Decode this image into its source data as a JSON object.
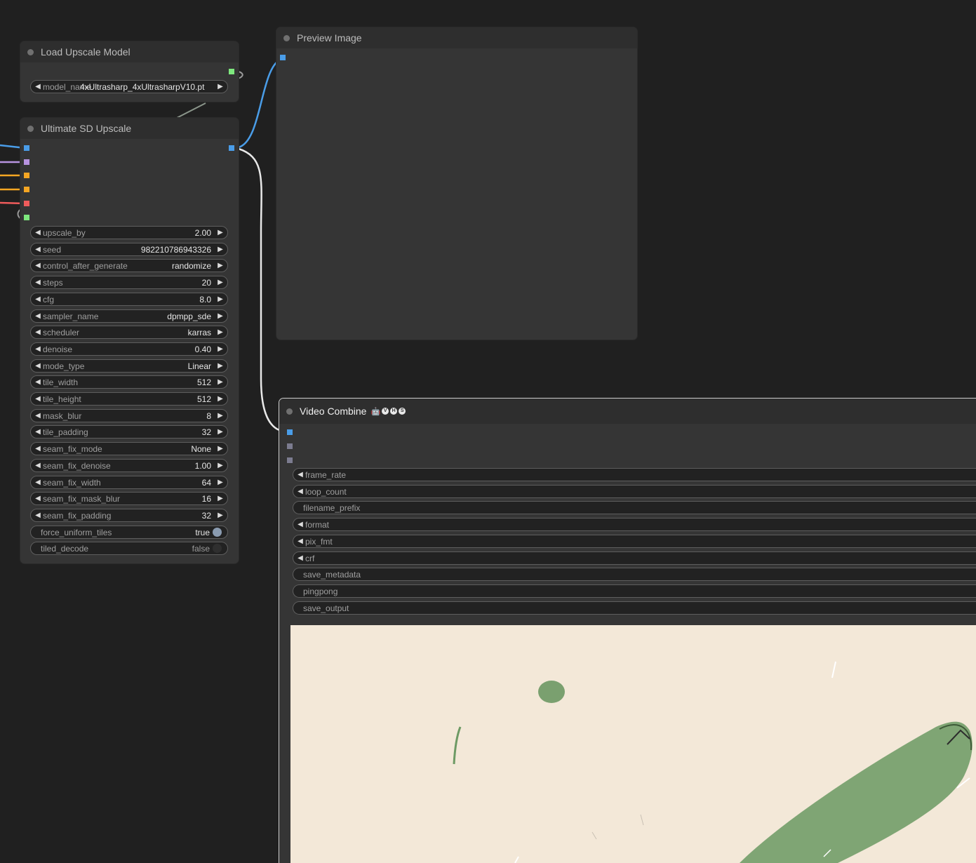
{
  "nodes": {
    "load_upscale": {
      "title": "Load Upscale Model",
      "model_name": {
        "label": "model_name",
        "value": "4xUltrasharp_4xUltrasharpV10.pt"
      }
    },
    "preview": {
      "title": "Preview Image"
    },
    "ultimate": {
      "title": "Ultimate SD Upscale",
      "widgets": [
        {
          "label": "upscale_by",
          "value": "2.00"
        },
        {
          "label": "seed",
          "value": "982210786943326"
        },
        {
          "label": "control_after_generate",
          "value": "randomize"
        },
        {
          "label": "steps",
          "value": "20"
        },
        {
          "label": "cfg",
          "value": "8.0"
        },
        {
          "label": "sampler_name",
          "value": "dpmpp_sde"
        },
        {
          "label": "scheduler",
          "value": "karras"
        },
        {
          "label": "denoise",
          "value": "0.40"
        },
        {
          "label": "mode_type",
          "value": "Linear"
        },
        {
          "label": "tile_width",
          "value": "512"
        },
        {
          "label": "tile_height",
          "value": "512"
        },
        {
          "label": "mask_blur",
          "value": "8"
        },
        {
          "label": "tile_padding",
          "value": "32"
        },
        {
          "label": "seam_fix_mode",
          "value": "None"
        },
        {
          "label": "seam_fix_denoise",
          "value": "1.00"
        },
        {
          "label": "seam_fix_width",
          "value": "64"
        },
        {
          "label": "seam_fix_mask_blur",
          "value": "16"
        },
        {
          "label": "seam_fix_padding",
          "value": "32"
        }
      ],
      "toggles": [
        {
          "label": "force_uniform_tiles",
          "value": "true"
        },
        {
          "label": "tiled_decode",
          "value": "false"
        }
      ]
    },
    "video": {
      "title": "Video Combine",
      "badge_icons": [
        "robot-icon",
        "v-icon",
        "h-icon",
        "s-icon"
      ],
      "badges": [
        "V",
        "H",
        "S"
      ],
      "widgets": [
        {
          "label": "frame_rate",
          "arrow": true
        },
        {
          "label": "loop_count",
          "arrow": true
        },
        {
          "label": "filename_prefix",
          "arrow": false
        },
        {
          "label": "format",
          "arrow": true
        },
        {
          "label": "pix_fmt",
          "arrow": true
        },
        {
          "label": "crf",
          "arrow": true
        },
        {
          "label": "save_metadata",
          "arrow": false
        },
        {
          "label": "pingpong",
          "arrow": false
        },
        {
          "label": "save_output",
          "arrow": false
        }
      ]
    }
  },
  "colors": {
    "canvas": "#202020",
    "node": "#353535",
    "wire_image": "#4a9de8",
    "wire_model": "#b793e0",
    "wire_conditioning": "#f5a623",
    "wire_vae": "#ee5b5b",
    "wire_upscale_model": "#7ee87e",
    "wire_white": "#e8e8e8"
  }
}
